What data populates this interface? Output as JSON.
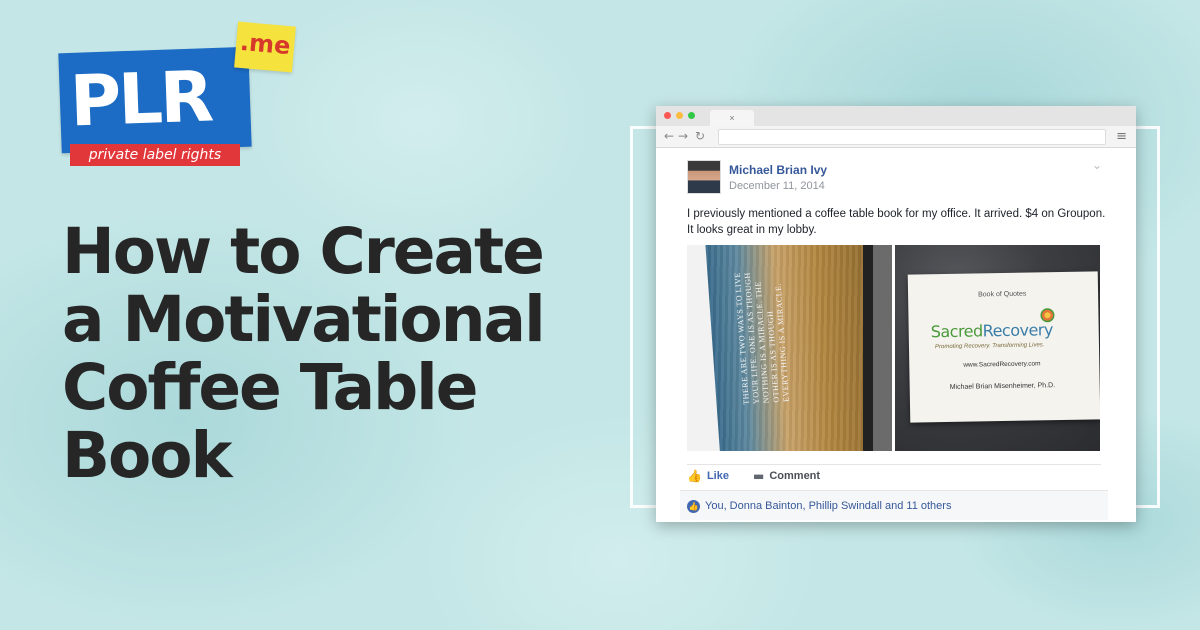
{
  "logo": {
    "letters": "PLR",
    "suffix": ".me",
    "tagline": "private label rights"
  },
  "headline": {
    "lines": [
      "How to Create",
      "a Motivational",
      "Coffee Table",
      "Book"
    ]
  },
  "browser": {
    "tab_close": "×",
    "post": {
      "author": "Michael Brian Ivy",
      "date": "December 11, 2014",
      "text": "I previously mentioned a coffee table book for my office. It arrived. $4 on Groupon. It looks great in my lobby.",
      "photo_left_quote": "There are two ways to live your life. One is as though nothing is a miracle. The other is as though everything is a miracle.",
      "photo_right": {
        "label": "Book of Quotes",
        "brand_part1": "Sacred",
        "brand_part2": "Recovery",
        "brand_subtitle": "Promoting Recovery. Transforming Lives.",
        "url": "www.SacredRecovery.com",
        "author": "Michael Brian Misenheimer, Ph.D."
      },
      "actions": {
        "like": "Like",
        "comment": "Comment"
      },
      "reactions_text": "You, Donna Bainton, Phillip Swindall and 11 others"
    }
  },
  "colors": {
    "background": "#c4e6e6",
    "logo_blue": "#1c6bc4",
    "logo_yellow": "#f5e23c",
    "logo_red": "#e2373a",
    "headline": "#262626",
    "facebook_blue": "#365899"
  },
  "icons": {
    "back": "←",
    "forward": "→",
    "reload": "↻",
    "menu": "≡",
    "chevron": "⌄",
    "like": "👍",
    "comment": "▬"
  }
}
